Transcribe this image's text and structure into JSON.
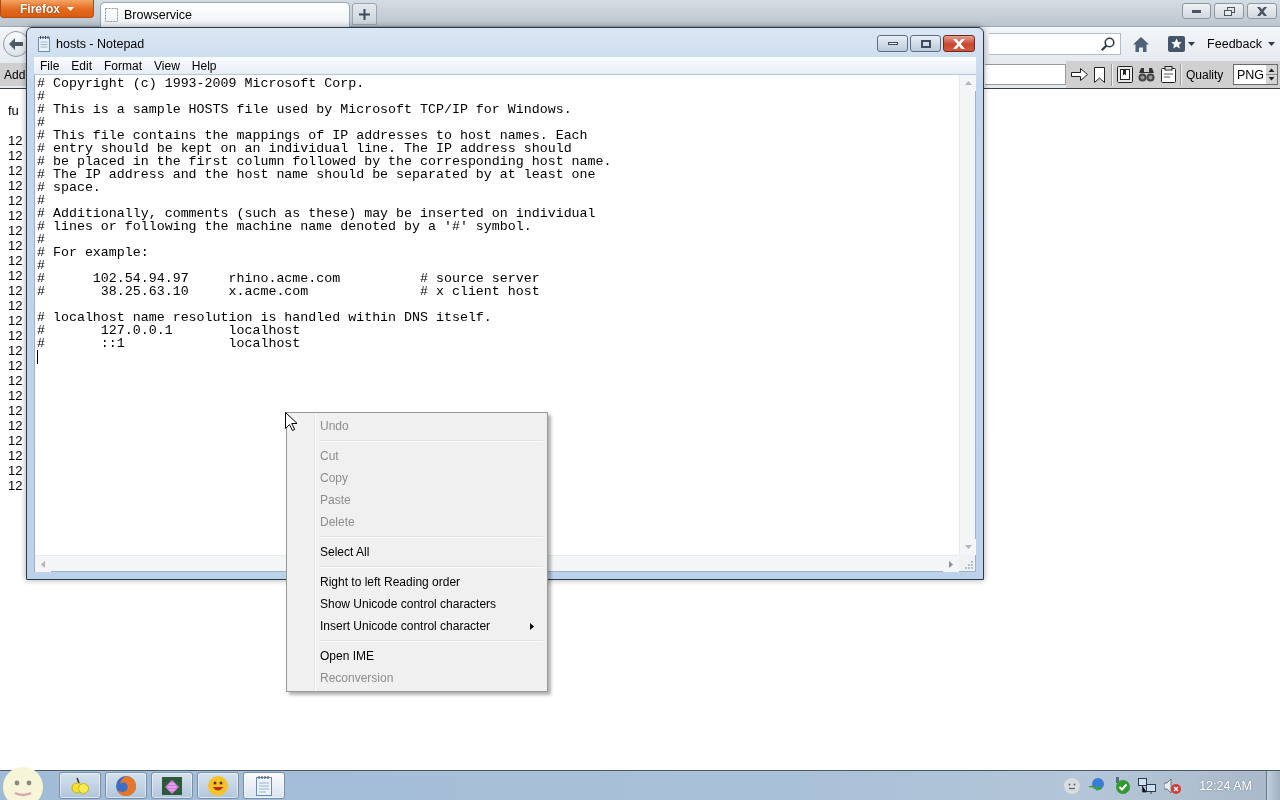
{
  "browser": {
    "app_button": "Firefox",
    "tabs": [
      {
        "label": "Browservice",
        "selected": true
      }
    ],
    "nav_bar": {
      "menu_button": "Feedback"
    },
    "toolbar": {
      "label": "Add",
      "quality_label": "Quality",
      "quality_value": "PNG"
    },
    "page": {
      "paragraphs": [
        [
          "fu"
        ],
        [
          "12",
          "12",
          "12",
          "12",
          "12",
          "12",
          "12",
          "12",
          "12",
          "12",
          "12",
          "12",
          "12",
          "12",
          "12",
          "12",
          "12",
          "12",
          "12",
          "12",
          "12",
          "12",
          "12",
          "12"
        ]
      ]
    }
  },
  "notepad": {
    "title": "hosts - Notepad",
    "menu": [
      "File",
      "Edit",
      "Format",
      "View",
      "Help"
    ],
    "text": "# Copyright (c) 1993-2009 Microsoft Corp.\n#\n# This is a sample HOSTS file used by Microsoft TCP/IP for Windows.\n#\n# This file contains the mappings of IP addresses to host names. Each\n# entry should be kept on an individual line. The IP address should\n# be placed in the first column followed by the corresponding host name.\n# The IP address and the host name should be separated by at least one\n# space.\n#\n# Additionally, comments (such as these) may be inserted on individual\n# lines or following the machine name denoted by a '#' symbol.\n#\n# For example:\n#\n#      102.54.94.97     rhino.acme.com          # source server\n#       38.25.63.10     x.acme.com              # x client host\n\n# localhost name resolution is handled within DNS itself.\n#       127.0.0.1       localhost\n#       ::1             localhost"
  },
  "context_menu": {
    "groups": [
      [
        {
          "label": "Undo",
          "disabled": true,
          "has_submenu": false
        }
      ],
      [
        {
          "label": "Cut",
          "disabled": true,
          "has_submenu": false
        },
        {
          "label": "Copy",
          "disabled": true,
          "has_submenu": false
        },
        {
          "label": "Paste",
          "disabled": true,
          "has_submenu": false
        },
        {
          "label": "Delete",
          "disabled": true,
          "has_submenu": false
        }
      ],
      [
        {
          "label": "Select All",
          "disabled": false,
          "has_submenu": false
        }
      ],
      [
        {
          "label": "Right to left Reading order",
          "disabled": false,
          "has_submenu": false
        },
        {
          "label": "Show Unicode control characters",
          "disabled": false,
          "has_submenu": false
        },
        {
          "label": "Insert Unicode control character",
          "disabled": false,
          "has_submenu": true
        }
      ],
      [
        {
          "label": "Open IME",
          "disabled": false,
          "has_submenu": false
        },
        {
          "label": "Reconversion",
          "disabled": true,
          "has_submenu": false
        }
      ]
    ]
  },
  "taskbar": {
    "buttons": [
      {
        "selected": false
      },
      {
        "selected": false
      },
      {
        "selected": false
      },
      {
        "selected": false
      },
      {
        "selected": true
      }
    ],
    "clock": "12:24 AM"
  }
}
